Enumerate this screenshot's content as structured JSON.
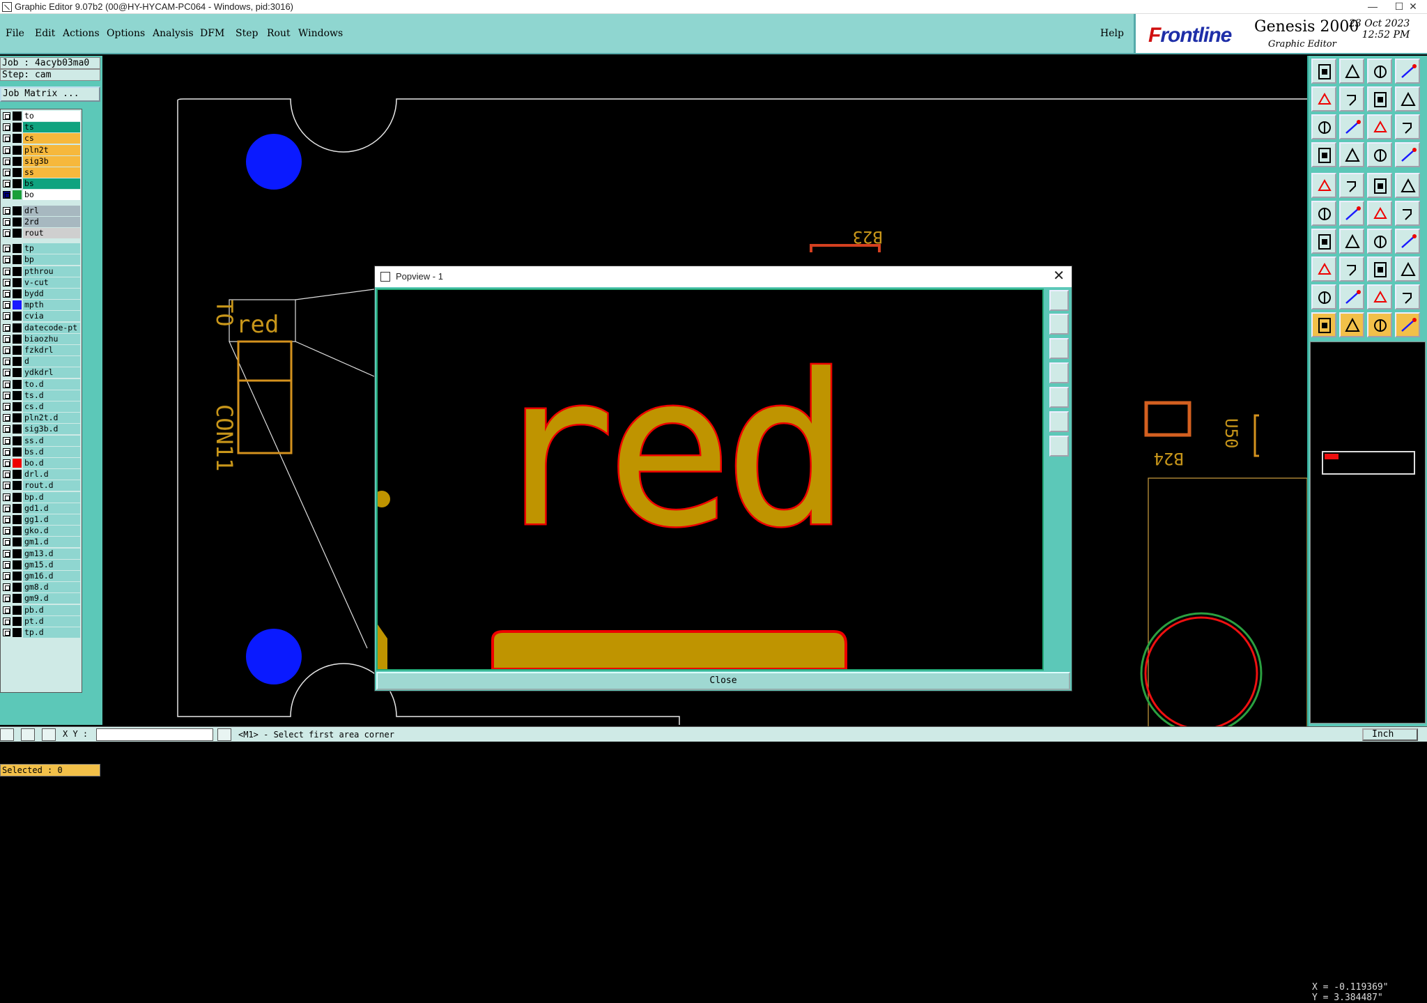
{
  "window": {
    "title": "Graphic Editor 9.07b2 (00@HY-HYCAM-PC064 - Windows, pid:3016)",
    "min": "—",
    "max": "☐",
    "close": "✕"
  },
  "menu": [
    {
      "label": "File"
    },
    {
      "label": "Edit"
    },
    {
      "label": "Actions"
    },
    {
      "label": "Options"
    },
    {
      "label": "Analysis"
    },
    {
      "label": "DFM"
    },
    {
      "label": "Step"
    },
    {
      "label": "Rout"
    },
    {
      "label": "Windows"
    }
  ],
  "help": "Help",
  "brand": {
    "logo": "Frontline",
    "product": "Genesis 2000",
    "subtitle": "Graphic Editor",
    "date": "23 Oct 2023",
    "time": "12:52 PM"
  },
  "job": {
    "job": "Job : 4acyb03ma0",
    "step": "Step: cam",
    "matrix": "Job Matrix ..."
  },
  "layers": [
    {
      "name": "to",
      "bg": "#ffffff",
      "color": "#000000"
    },
    {
      "name": "ts",
      "bg": "#0fa37f",
      "color": "#000000"
    },
    {
      "name": "cs",
      "bg": "#f6b83c",
      "color": "#000000"
    },
    {
      "name": "pln2t",
      "bg": "#f6b83c",
      "color": "#000000"
    },
    {
      "name": "sig3b",
      "bg": "#f6b83c",
      "color": "#000000"
    },
    {
      "name": "ss",
      "bg": "#f6b83c",
      "color": "#000000"
    },
    {
      "name": "bs",
      "bg": "#0fa37f",
      "color": "#000000"
    },
    {
      "name": "bo",
      "bg": "#ffffff",
      "color": "#1aa03a",
      "marker": "#00007a"
    },
    {
      "name": "drl",
      "bg": "#a7b8c0",
      "color": "#000000",
      "gap": true
    },
    {
      "name": "2rd",
      "bg": "#a7b8c0",
      "color": "#000000"
    },
    {
      "name": "rout",
      "bg": "#cfcfcf",
      "color": "#000000"
    },
    {
      "name": "tp",
      "bg": "#8fd6d0",
      "color": "#000000",
      "gap": true
    },
    {
      "name": "bp",
      "bg": "#8fd6d0",
      "color": "#000000"
    },
    {
      "name": "pthrou",
      "bg": "#8fd6d0",
      "color": "#000000"
    },
    {
      "name": "v-cut",
      "bg": "#8fd6d0",
      "color": "#000000"
    },
    {
      "name": "bydd",
      "bg": "#8fd6d0",
      "color": "#000000"
    },
    {
      "name": "mpth",
      "bg": "#8fd6d0",
      "color": "#1a1aff"
    },
    {
      "name": "cvia",
      "bg": "#8fd6d0",
      "color": "#000000"
    },
    {
      "name": "datecode-pt",
      "bg": "#8fd6d0",
      "color": "#000000"
    },
    {
      "name": "biaozhu",
      "bg": "#8fd6d0",
      "color": "#000000"
    },
    {
      "name": "fzkdrl",
      "bg": "#8fd6d0",
      "color": "#000000"
    },
    {
      "name": "d",
      "bg": "#8fd6d0",
      "color": "#000000"
    },
    {
      "name": "ydkdrl",
      "bg": "#8fd6d0",
      "color": "#000000"
    },
    {
      "name": "to.d",
      "bg": "#8fd6d0",
      "color": "#000000"
    },
    {
      "name": "ts.d",
      "bg": "#8fd6d0",
      "color": "#000000"
    },
    {
      "name": "cs.d",
      "bg": "#8fd6d0",
      "color": "#000000"
    },
    {
      "name": "pln2t.d",
      "bg": "#8fd6d0",
      "color": "#000000"
    },
    {
      "name": "sig3b.d",
      "bg": "#8fd6d0",
      "color": "#000000"
    },
    {
      "name": "ss.d",
      "bg": "#8fd6d0",
      "color": "#000000"
    },
    {
      "name": "bs.d",
      "bg": "#8fd6d0",
      "color": "#000000"
    },
    {
      "name": "bo.d",
      "bg": "#8fd6d0",
      "color": "#ee0000"
    },
    {
      "name": "drl.d",
      "bg": "#8fd6d0",
      "color": "#000000"
    },
    {
      "name": "rout.d",
      "bg": "#8fd6d0",
      "color": "#000000"
    },
    {
      "name": "bp.d",
      "bg": "#8fd6d0",
      "color": "#000000"
    },
    {
      "name": "gd1.d",
      "bg": "#8fd6d0",
      "color": "#000000"
    },
    {
      "name": "gg1.d",
      "bg": "#8fd6d0",
      "color": "#000000"
    },
    {
      "name": "gko.d",
      "bg": "#8fd6d0",
      "color": "#000000"
    },
    {
      "name": "gm1.d",
      "bg": "#8fd6d0",
      "color": "#000000"
    },
    {
      "name": "gm13.d",
      "bg": "#8fd6d0",
      "color": "#000000"
    },
    {
      "name": "gm15.d",
      "bg": "#8fd6d0",
      "color": "#000000"
    },
    {
      "name": "gm16.d",
      "bg": "#8fd6d0",
      "color": "#000000"
    },
    {
      "name": "gm8.d",
      "bg": "#8fd6d0",
      "color": "#000000"
    },
    {
      "name": "gm9.d",
      "bg": "#8fd6d0",
      "color": "#000000"
    },
    {
      "name": "pb.d",
      "bg": "#8fd6d0",
      "color": "#000000"
    },
    {
      "name": "pt.d",
      "bg": "#8fd6d0",
      "color": "#000000"
    },
    {
      "name": "tp.d",
      "bg": "#8fd6d0",
      "color": "#000000"
    }
  ],
  "selected": "Selected : 0",
  "status": {
    "xy_label": "X Y :",
    "xy_value": "",
    "message": "<M1> - Select first area corner",
    "unit": "Inch"
  },
  "coords": {
    "x": "X = -0.119369\"",
    "y": "Y = 3.384487\""
  },
  "popview": {
    "title": "Popview - 1",
    "close_label": "Close"
  },
  "pcb": {
    "silk_red": "red",
    "silk_to": "TO",
    "silk_con": "CON11",
    "ref_b23": "B23",
    "ref_b24": "B24",
    "ref_u50": "U50"
  },
  "tools": [
    "move-icon",
    "home-view-icon",
    "house-icon",
    "window-icon",
    "step-in-icon",
    "step-out-icon",
    "flip-icon",
    "redraw-icon",
    "zoom-fit-icon",
    "zoom-center-icon",
    "zoom-1to2-icon",
    "query-icon",
    "layers-icon",
    "grid-icon",
    "snap-icon",
    "snap-red-icon",
    "pad-icon",
    "measure-icon",
    "line-icon",
    "circle-icon",
    "vertex-icon",
    "cross-icon",
    "point-icon",
    "node-icon",
    "angle-icon",
    "diag-line-icon",
    "arc-icon",
    "text-icon",
    "pad-add-icon",
    "minus-icon",
    "center-icon",
    "array-icon",
    "triangle-icon",
    "triangle-2-icon",
    "triangle-3-icon",
    "triangle-4-icon",
    "select-icon",
    "select-2-icon",
    "select-3-icon",
    "select-4-icon"
  ],
  "colors": {
    "accent": "#5cc8b8",
    "menu": "#8fd6d0",
    "copper": "#bf9400",
    "outline": "#ee0000",
    "via": "#0a1aff"
  }
}
